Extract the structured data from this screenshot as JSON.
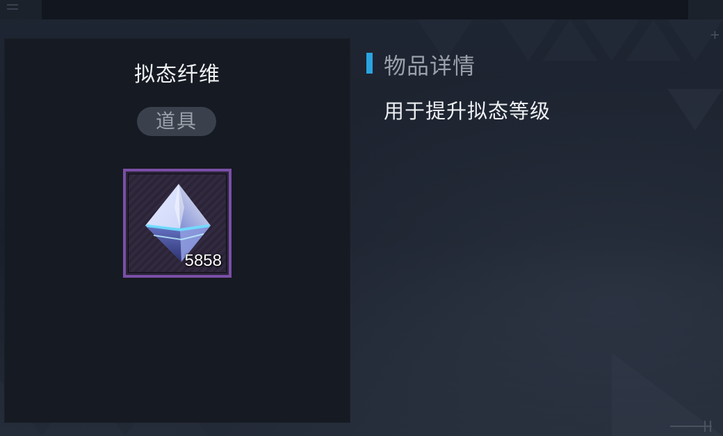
{
  "item": {
    "name": "拟态纤维",
    "type_label": "道具",
    "count": "5858",
    "frame_color": "#7a4fa6",
    "icon": "crystal-icon"
  },
  "detail": {
    "section_title": "物品详情",
    "accent_color": "#2ba3e0",
    "description": "用于提升拟态等级"
  }
}
